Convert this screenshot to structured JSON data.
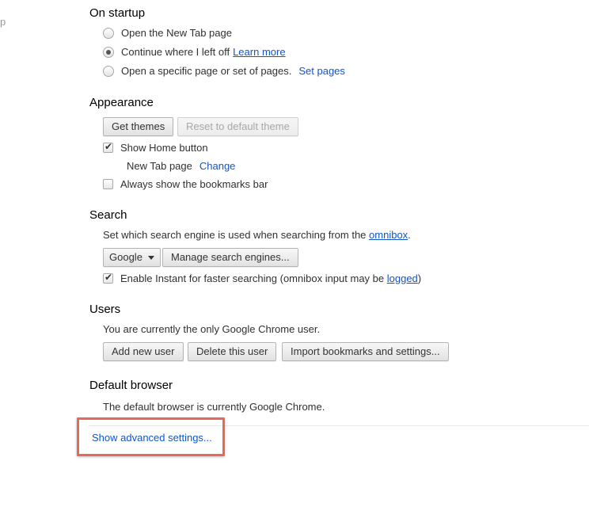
{
  "side_fragment": "p",
  "startup": {
    "title": "On startup",
    "options": [
      {
        "label": "Open the New Tab page",
        "checked": false
      },
      {
        "label": "Continue where I left off",
        "checked": true,
        "link": "Learn more"
      },
      {
        "label": "Open a specific page or set of pages.",
        "checked": false,
        "link": "Set pages"
      }
    ]
  },
  "appearance": {
    "title": "Appearance",
    "get_themes": "Get themes",
    "reset_theme": "Reset to default theme",
    "show_home": {
      "label": "Show Home button",
      "checked": true
    },
    "home_page_label": "New Tab page",
    "change_link": "Change",
    "bookmarks_bar": {
      "label": "Always show the bookmarks bar",
      "checked": false
    }
  },
  "search": {
    "title": "Search",
    "description_prefix": "Set which search engine is used when searching from the ",
    "description_link": "omnibox",
    "description_suffix": ".",
    "engine_selected": "Google",
    "manage_button": "Manage search engines...",
    "instant": {
      "label_prefix": "Enable Instant for faster searching (omnibox input may be ",
      "link": "logged",
      "label_suffix": ")",
      "checked": true
    }
  },
  "users": {
    "title": "Users",
    "description": "You are currently the only Google Chrome user.",
    "add_button": "Add new user",
    "delete_button": "Delete this user",
    "import_button": "Import bookmarks and settings..."
  },
  "default_browser": {
    "title": "Default browser",
    "description": "The default browser is currently Google Chrome."
  },
  "advanced_link": "Show advanced settings...",
  "colors": {
    "link": "#1155cc",
    "highlight": "#e9675a"
  }
}
